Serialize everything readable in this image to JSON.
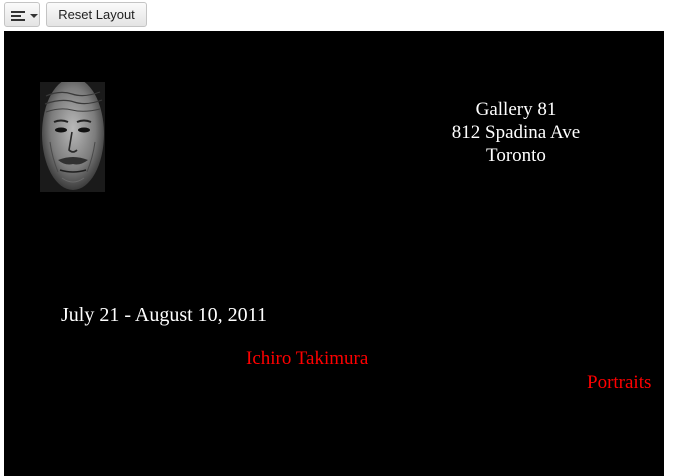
{
  "toolbar": {
    "align_icon": "align-left-icon",
    "reset_label": "Reset Layout"
  },
  "canvas": {
    "background": "#000000",
    "portrait_image": "portrait-photo",
    "address": {
      "line1": "Gallery 81",
      "line2": "812 Spadina Ave",
      "line3": "Toronto"
    },
    "dates": "July 21 - August 10, 2011",
    "artist": "Ichiro Takimura",
    "series": "Portraits",
    "accent_color": "#ff0000"
  }
}
